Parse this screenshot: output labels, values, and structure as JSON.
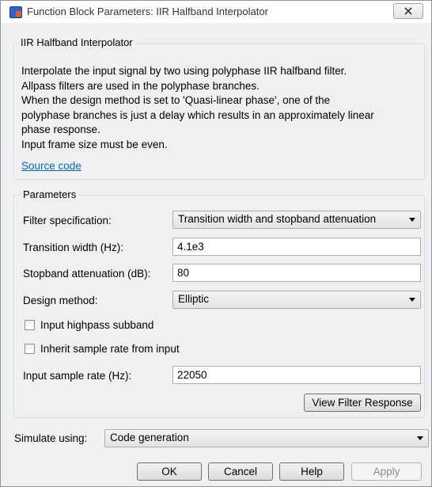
{
  "window": {
    "title": "Function Block Parameters: IIR Halfband Interpolator"
  },
  "block_group": {
    "title": "IIR Halfband Interpolator",
    "description_lines": [
      "Interpolate the input signal by two using polyphase IIR halfband filter.",
      "Allpass filters are used in the polyphase branches.",
      "When the design method is set to 'Quasi-linear phase', one of the",
      "polyphase branches is just a delay which results in an approximately linear",
      "phase response.",
      "Input frame size must be even."
    ],
    "source_link": "Source code"
  },
  "parameters": {
    "title": "Parameters",
    "filter_spec_label": "Filter specification:",
    "filter_spec_value": "Transition width and stopband attenuation",
    "transition_width_label": "Transition width (Hz):",
    "transition_width_value": "4.1e3",
    "stopband_label": "Stopband attenuation (dB):",
    "stopband_value": "80",
    "design_method_label": "Design method:",
    "design_method_value": "Elliptic",
    "highpass_label": "Input highpass subband",
    "highpass_checked": false,
    "inherit_rate_label": "Inherit sample rate from input",
    "inherit_rate_checked": false,
    "sample_rate_label": "Input sample rate (Hz):",
    "sample_rate_value": "22050",
    "view_response_label": "View Filter Response"
  },
  "simulate": {
    "label": "Simulate using:",
    "value": "Code generation"
  },
  "buttons": {
    "ok": "OK",
    "cancel": "Cancel",
    "help": "Help",
    "apply": "Apply"
  }
}
